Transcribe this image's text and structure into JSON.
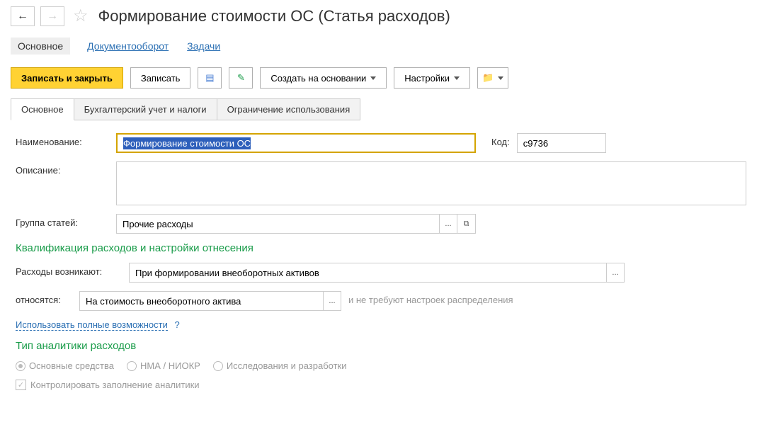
{
  "header": {
    "title": "Формирование стоимости ОС (Статья расходов)"
  },
  "linkTabs": {
    "main": "Основное",
    "workflow": "Документооборот",
    "tasks": "Задачи"
  },
  "toolbar": {
    "saveClose": "Записать и закрыть",
    "save": "Записать",
    "createBased": "Создать на основании",
    "settings": "Настройки"
  },
  "contentTabs": {
    "main": "Основное",
    "accounting": "Бухгалтерский учет и налоги",
    "restriction": "Ограничение использования"
  },
  "form": {
    "nameLabel": "Наименование:",
    "nameValue": "Формирование стоимости ОС",
    "codeLabel": "Код:",
    "codeValue": "с9736",
    "descLabel": "Описание:",
    "descValue": "",
    "groupLabel": "Группа статей:",
    "groupValue": "Прочие расходы",
    "section1Title": "Квалификация расходов и настройки отнесения",
    "expensesOccurLabel": "Расходы возникают:",
    "expensesOccurValue": "При формировании внеоборотных активов",
    "relatesLabel": "относятся:",
    "relatesValue": "На стоимость внеоборотного актива",
    "relatesHint": "и не требуют настроек распределения",
    "fullCapLink": "Использовать полные возможности",
    "section2Title": "Тип аналитики расходов",
    "radio1": "Основные средства",
    "radio2": "НМА / НИОКР",
    "radio3": "Исследования и разработки",
    "checkboxLabel": "Контролировать заполнение аналитики"
  }
}
